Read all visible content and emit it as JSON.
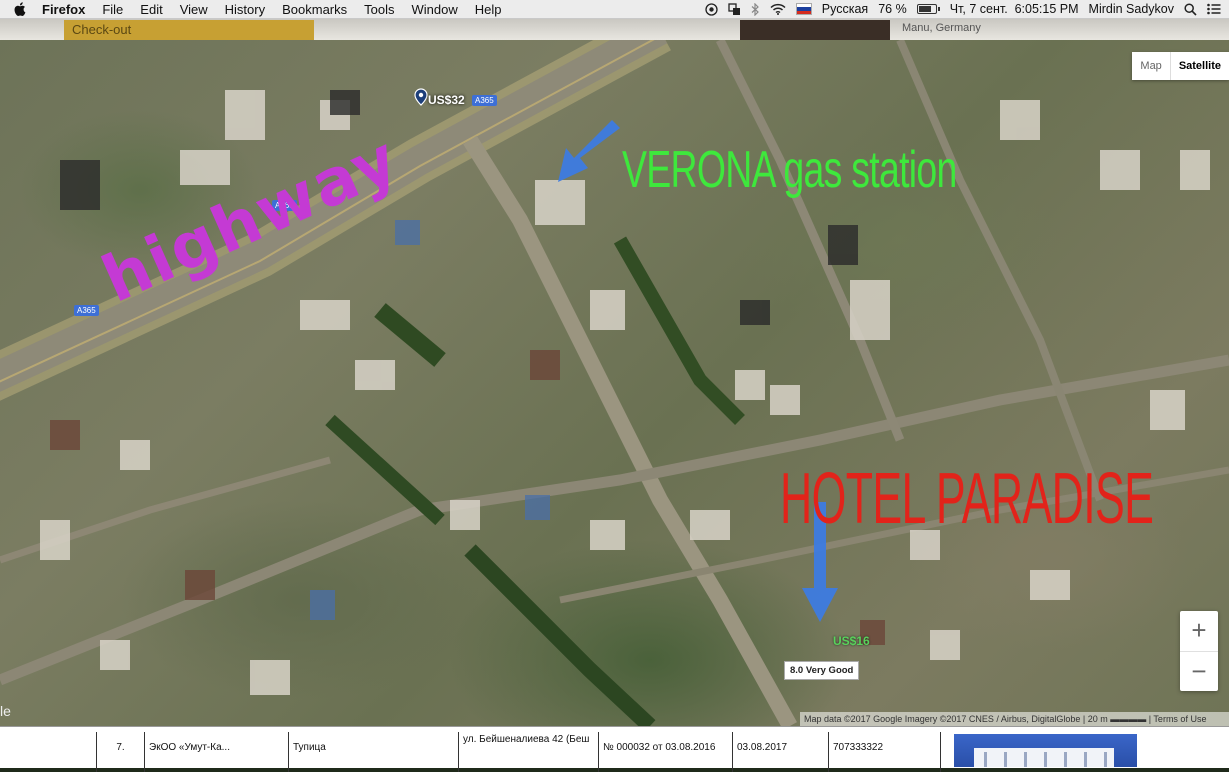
{
  "menubar": {
    "app_name": "Firefox",
    "menus": [
      "File",
      "Edit",
      "View",
      "History",
      "Bookmarks",
      "Tools",
      "Window",
      "Help"
    ],
    "language": "Русская",
    "battery": "76 %",
    "datetime": "Чт, 7 сент.  6:05:15 PM",
    "user": "Mirdin Sadykov",
    "flag_colors": [
      "#ffffff",
      "#1c3f9e",
      "#d52b1e"
    ]
  },
  "page_top": {
    "checkout_label": "Check-out",
    "place_text": "Manu, Germany"
  },
  "map": {
    "type_buttons": {
      "map": "Map",
      "satellite": "Satellite"
    },
    "zoom_in": "+",
    "zoom_out": "−",
    "road_labels": [
      "A365",
      "A365",
      "A365"
    ],
    "markers": [
      {
        "price": "US$32"
      },
      {
        "price": "US$16",
        "rating": "8.0 Very Good"
      }
    ],
    "annotations": {
      "gas_station": "VERONA gas station",
      "hotel": "HOTEL PARADISE",
      "highway": "highway"
    },
    "annotation_colors": {
      "gas_station": "#3ee83c",
      "hotel": "#e2231a",
      "highway": "#c43ad4",
      "arrows": "#3d7be0"
    },
    "attribution": "Map data ©2017 Google Imagery ©2017 CNES / Airbus, DigitalGlobe  |  20 m ▬▬▬▬  |  Terms of Use",
    "edge_text": "le"
  },
  "document_row": {
    "cells": [
      "7.",
      "ЭкОО «Умут-Ка...",
      "Тупица",
      "ул. Бейшеналиева 42 (Беш",
      "№ 000032 от 03.08.2016",
      "03.08.2017",
      "707333322"
    ]
  }
}
